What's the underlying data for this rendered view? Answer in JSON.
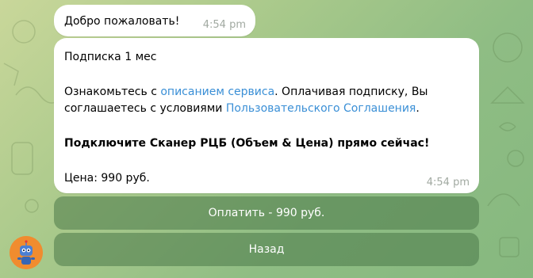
{
  "messages": [
    {
      "text": "Добро пожаловать!",
      "time": "4:54 pm"
    },
    {
      "line1": "Подписка 1 мес",
      "line2_prefix": "Ознакомьтесь с ",
      "line2_link": "описанием сервиса",
      "line2_suffix": ". Оплачивая подписку, Вы",
      "line3_prefix": "соглашаетесь с условиями ",
      "line3_link": "Пользовательского Соглашения",
      "line3_suffix": ".",
      "line4": "Подключите Сканер РЦБ (Объем & Цена) прямо сейчас!",
      "line5": "Цена: 990 руб.",
      "time": "4:54 pm"
    }
  ],
  "keyboard": {
    "pay_label": "Оплатить - 990 руб.",
    "back_label": "Назад"
  },
  "colors": {
    "link": "#3a8fd6",
    "bubble": "#ffffff",
    "button": "#4a7848"
  },
  "icons": {
    "avatar": "bot-avatar"
  }
}
